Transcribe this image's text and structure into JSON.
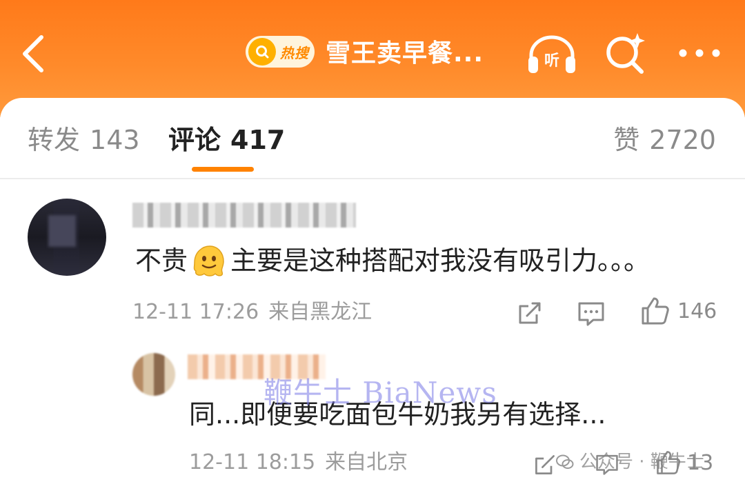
{
  "topbar": {
    "hot_badge": "热搜",
    "title": "雪王卖早餐...",
    "listen_icon_text": "听",
    "colors": {
      "background": "#ff8a2a",
      "foreground": "#ffffff"
    }
  },
  "tabs": [
    {
      "label": "转发",
      "count": "143",
      "active": false
    },
    {
      "label": "评论",
      "count": "417",
      "active": true
    },
    {
      "label": "赞",
      "count": "2720",
      "active": false
    }
  ],
  "comments": [
    {
      "text_before_emoji": "不贵",
      "emoji": "melting-face-emoji",
      "text_after_emoji": "主要是这种搭配对我没有吸引力。。。",
      "time": "12-11 17:26",
      "location": "来自黑龙江",
      "likes": "146"
    }
  ],
  "reply": {
    "text": "同...即便要吃面包牛奶我另有选择...",
    "time": "12-11 18:15",
    "location": "来自北京",
    "likes": "13"
  },
  "watermarks": {
    "center": "鞭牛士 BiaNews",
    "corner": "公众号 · 鞭牛士"
  },
  "accent_color": "#ff8200"
}
